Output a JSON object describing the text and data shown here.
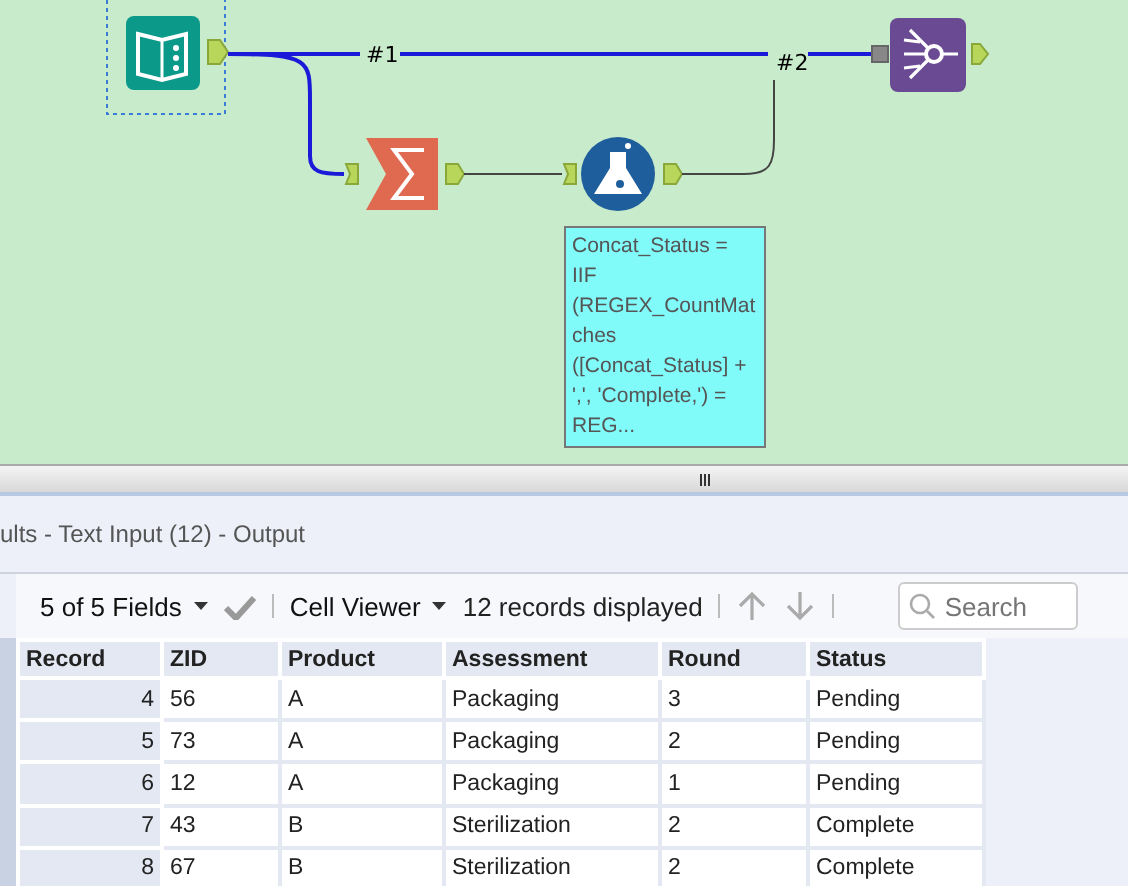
{
  "canvas": {
    "connections": [
      {
        "label": "#1"
      },
      {
        "label": "#2"
      }
    ],
    "annotation": "Concat_Status = IIF (REGEX_CountMatches ([Concat_Status] + ',', 'Complete,') = REG..."
  },
  "results": {
    "title": "ults - Text Input (12) - Output",
    "toolbar": {
      "fields": "5 of 5 Fields",
      "viewer": "Cell Viewer",
      "count": "12 records displayed",
      "search_placeholder": "Search"
    },
    "table": {
      "columns": [
        "Record",
        "ZID",
        "Product",
        "Assessment",
        "Round",
        "Status"
      ],
      "rows": [
        [
          "4",
          "56",
          "A",
          "Packaging",
          "3",
          "Pending"
        ],
        [
          "5",
          "73",
          "A",
          "Packaging",
          "2",
          "Pending"
        ],
        [
          "6",
          "12",
          "A",
          "Packaging",
          "1",
          "Pending"
        ],
        [
          "7",
          "43",
          "B",
          "Sterilization",
          "2",
          "Complete"
        ],
        [
          "8",
          "67",
          "B",
          "Sterilization",
          "2",
          "Complete"
        ]
      ]
    }
  }
}
